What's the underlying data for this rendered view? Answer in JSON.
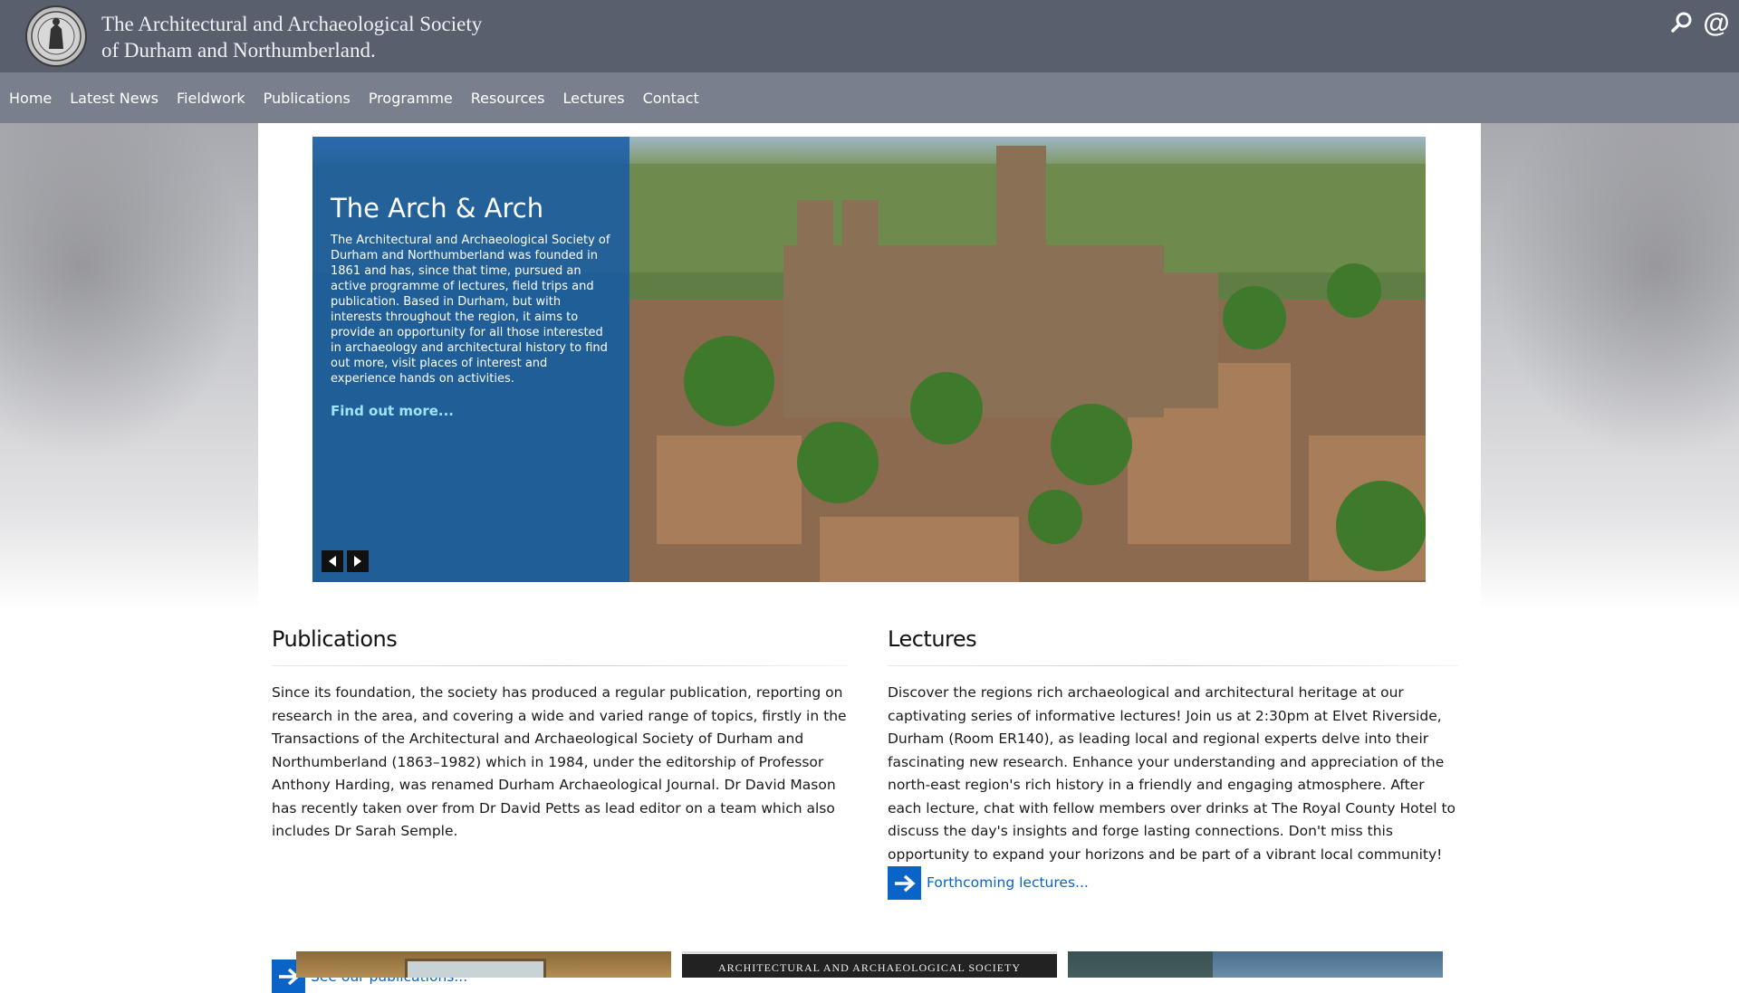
{
  "header": {
    "title_line1": "The Architectural and Archaeological Society",
    "title_line2": "of Durham and Northumberland.",
    "search_icon": "search-icon",
    "contact_icon": "at-icon"
  },
  "nav": {
    "items": [
      "Home",
      "Latest News",
      "Fieldwork",
      "Publications",
      "Programme",
      "Resources",
      "Lectures",
      "Contact"
    ]
  },
  "slider": {
    "heading": "The Arch & Arch",
    "text": "The Architectural and Archaeological Society of Durham and Northumberland was founded in 1861 and has, since that time, pursued an active programme of lectures, field trips and publication. Based in Durham, but with interests throughout the region, it aims to provide an opportunity for all those interested in archaeology and architectural history to find out more, visit places of interest and experience hands on activities.",
    "link": "Find out more...",
    "prev_icon": "arrow-left-icon",
    "next_icon": "arrow-right-icon"
  },
  "publications": {
    "heading": "Publications",
    "text": "Since its foundation, the society has produced a regular publication, reporting on research in the area, and covering a wide and varied range of topics, firstly in the Transactions of the Architectural and Archaeological Society of Durham and Northumberland (1863–1982) which in 1984, under the editorship of Professor Anthony Harding, was renamed Durham Archaeological Journal. Dr David Mason has recently taken over from Dr David Petts as lead editor on a team which also includes Dr Sarah Semple.",
    "link": "See our publications..."
  },
  "lectures": {
    "heading": "Lectures",
    "text": "Discover the regions rich archaeological and architectural heritage at our captivating series of informative lectures! Join us at 2:30pm at Elvet Riverside, Durham (Room ER140), as leading local and regional experts delve into their fascinating new research. Enhance your understanding and appreciation of the north-east region's rich history in a friendly and engaging atmosphere. After each lecture, chat with fellow members over drinks at The Royal County Hotel to discuss the day's insights and forge lasting connections. Don't miss this opportunity to expand your horizons and be part of a vibrant local community!",
    "link": "Forthcoming lectures..."
  },
  "thumbs": {
    "journal_cover_text": "ARCHITECTURAL AND ARCHAEOLOGICAL SOCIETY"
  },
  "colors": {
    "header_bg": "#5a5f6e",
    "nav_bg": "#7a7f8e",
    "caption_bg": "#1258aa",
    "link_blue": "#0a64c8",
    "caption_link": "#9be3ff"
  }
}
